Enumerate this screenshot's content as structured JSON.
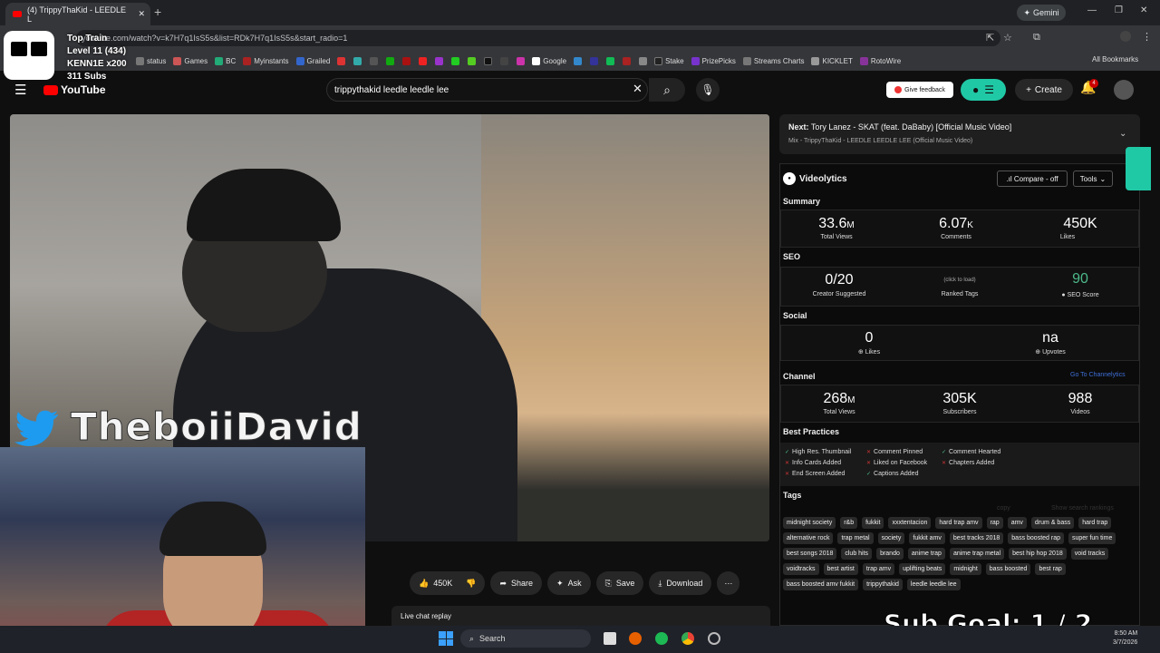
{
  "browser": {
    "tab_title": "(4) TrippyThaKid - LEEDLE L",
    "gemini_label": "Gemini",
    "url": "youtube.com/watch?v=k7H7q1IsS5s&list=RDk7H7q1IsS5s&start_radio=1",
    "all_bookmarks": "All Bookmarks",
    "bookmarks": [
      "status",
      "Games",
      "BC",
      "Myinstants",
      "Grailed",
      "Google",
      "Stake",
      "PrizePicks",
      "Streams Charts",
      "KICKLET",
      "RotoWire"
    ]
  },
  "overlay": {
    "line1": "Top Train",
    "line2": "Level 11  (434)",
    "line3": "KENN1E x200",
    "line4": "311 Subs"
  },
  "youtube": {
    "logo": "YouTube",
    "search_value": "trippythakid leedle leedle lee",
    "feedback": "Give feedback",
    "create": "Create",
    "bell_badge": "4"
  },
  "video": {
    "twitter_handle": "TheboiiDavid",
    "sub_goal": "Sub Goal:  1 / 2"
  },
  "actions": {
    "likes": "450K",
    "share": "Share",
    "ask": "Ask",
    "save": "Save",
    "download": "Download",
    "live_chat": "Live chat replay"
  },
  "next": {
    "title_prefix": "Next:",
    "title": "Tory Lanez - SKAT (feat. DaBaby) [Official Music Video]",
    "subtitle": "Mix - TrippyThaKid - LEEDLE LEEDLE LEE (Official Music Video)"
  },
  "videolytics": {
    "name": "Videolytics",
    "compare": ".ıl Compare - off",
    "tools": "Tools",
    "summary": {
      "title": "Summary",
      "views": "33.6",
      "views_unit": "M",
      "views_label": "Total Views",
      "comments": "6.07",
      "comments_unit": "K",
      "comments_label": "Comments",
      "likes": "450K",
      "likes_label": "Likes"
    },
    "seo": {
      "title": "SEO",
      "creator": "0/20",
      "creator_label": "Creator Suggested",
      "ranked_hint": "(click to load)",
      "ranked_label": "Ranked Tags",
      "score": "90",
      "score_label": "SEO Score"
    },
    "social": {
      "title": "Social",
      "likes": "0",
      "likes_label": "Likes",
      "upvotes": "na",
      "upvotes_label": "Upvotes"
    },
    "channel": {
      "title": "Channel",
      "link": "Go To Channelytics",
      "views": "268",
      "views_unit": "M",
      "views_label": "Total Views",
      "subs": "305K",
      "subs_label": "Subscribers",
      "videos": "988",
      "videos_label": "Videos"
    },
    "best_practices": {
      "title": "Best Practices",
      "items": [
        "High Res. Thumbnail",
        "Comment Pinned",
        "Comment Hearted",
        "Info Cards Added",
        "Liked on Facebook",
        "Chapters Added",
        "End Screen Added",
        "Captions Added"
      ]
    },
    "tags_title": "Tags",
    "copy": "copy",
    "show_rankings": "Show search rankings",
    "tags": [
      "midnight society",
      "r&b",
      "fukkit",
      "xxxtentacion",
      "hard trap amv",
      "rap",
      "amv",
      "drum & bass",
      "hard trap",
      "alternative rock",
      "trap metal",
      "society",
      "fukkit amv",
      "best tracks 2018",
      "bass boosted rap",
      "super fun time",
      "best songs 2018",
      "club hits",
      "brando",
      "anime trap",
      "anime trap metal",
      "best hip hop 2018",
      "void tracks",
      "voidtracks",
      "best artist",
      "trap amv",
      "uplifting beats",
      "midnight",
      "bass boosted",
      "best rap",
      "bass boosted amv fukkit",
      "trippythakid",
      "leedle leedle lee"
    ]
  },
  "taskbar": {
    "search": "Search",
    "time": "8:50 AM",
    "date": "3/7/2026"
  }
}
